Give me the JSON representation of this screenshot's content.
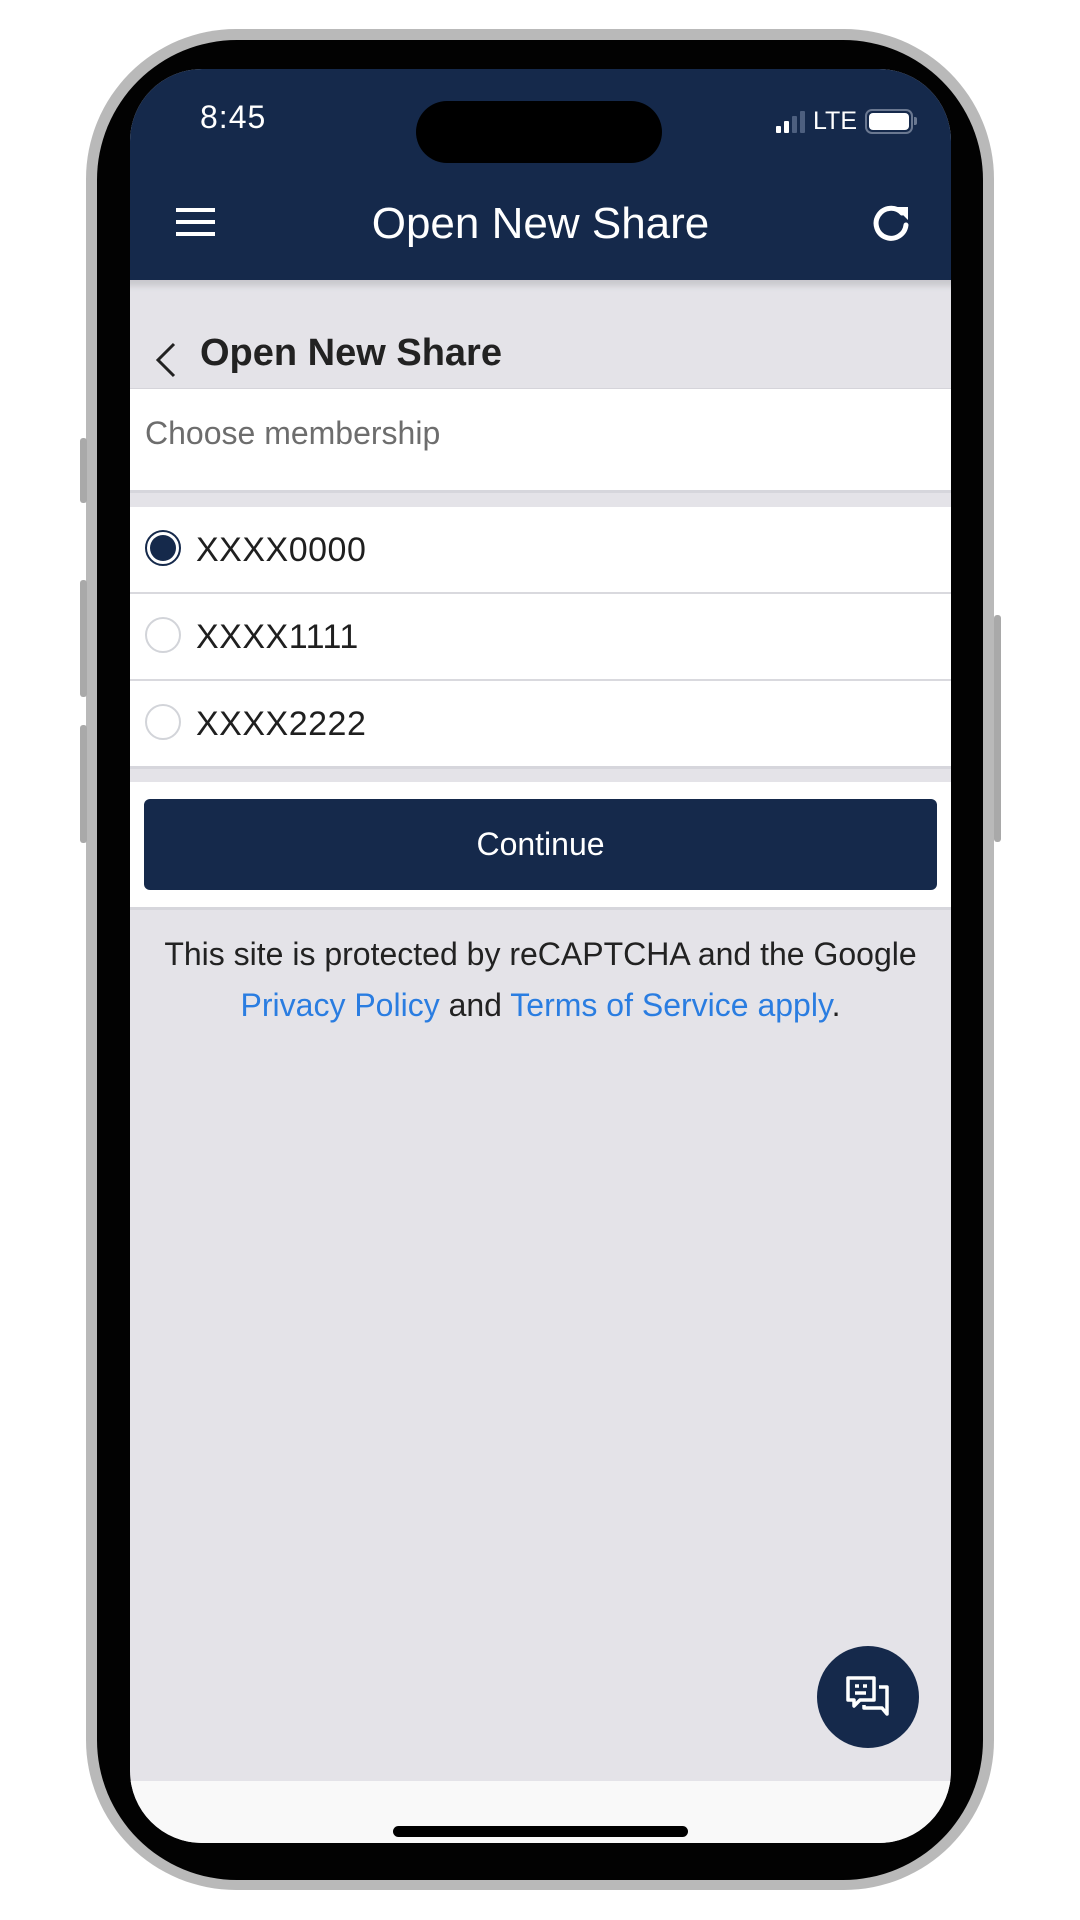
{
  "status_bar": {
    "time": "8:45",
    "network": "LTE",
    "signal_bars_active": 2,
    "signal_bars_total": 4,
    "battery_level": 1.0
  },
  "nav_bar": {
    "title": "Open New Share",
    "menu_icon": "hamburger-menu-icon",
    "refresh_icon": "refresh-icon"
  },
  "subheader": {
    "back_icon": "chevron-left-icon",
    "title": "Open New Share"
  },
  "membership": {
    "label": "Choose membership",
    "options": [
      {
        "label": "XXXX0000",
        "selected": true
      },
      {
        "label": "XXXX1111",
        "selected": false
      },
      {
        "label": "XXXX2222",
        "selected": false
      }
    ]
  },
  "actions": {
    "continue_label": "Continue"
  },
  "legal": {
    "prefix": "This site is protected by reCAPTCHA and the Google",
    "privacy_link": "Privacy Policy",
    "conjunction": "and",
    "terms_link": "Terms of Service apply",
    "suffix": "."
  },
  "chat": {
    "icon": "chat-bubbles-icon"
  },
  "colors": {
    "brand_navy": "#15294b",
    "link_blue": "#2a7de1",
    "background_gray": "#e4e3e8"
  }
}
